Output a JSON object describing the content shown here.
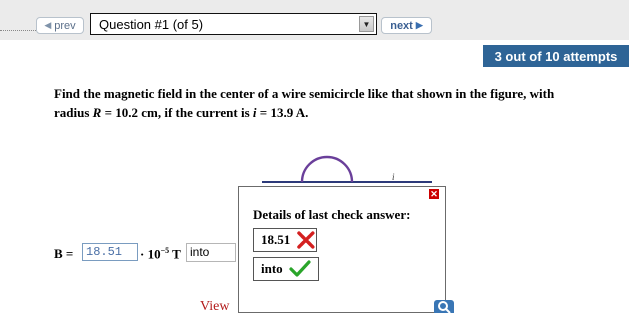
{
  "nav": {
    "prev_label": "prev",
    "question_select_value": "Question #1 (of 5)",
    "next_label": "next"
  },
  "attempts_badge": "3 out of 10 attempts",
  "problem": {
    "line1": "Find the magnetic field in the center of a wire semicircle like that shown in the figure, with",
    "line2_prefix": "radius ",
    "radius_var": "R",
    "radius_text": " = 10.2 cm, if the current is ",
    "current_var": "i",
    "current_text": " = 13.9 A."
  },
  "figure": {
    "current_label": "i"
  },
  "answer": {
    "var_label": "B =",
    "value": "18.51",
    "units_prefix": "· 10",
    "units_exp": "−5",
    "units_suffix": " T",
    "direction_value": "into"
  },
  "view_link": "View",
  "details_popup": {
    "title": "Details of last check answer:",
    "result1": "18.51",
    "result2": "into"
  },
  "colors": {
    "attempts_bg": "#2e6496",
    "wrong": "#d42020",
    "right": "#2aa52a",
    "link": "#b31b1b"
  }
}
